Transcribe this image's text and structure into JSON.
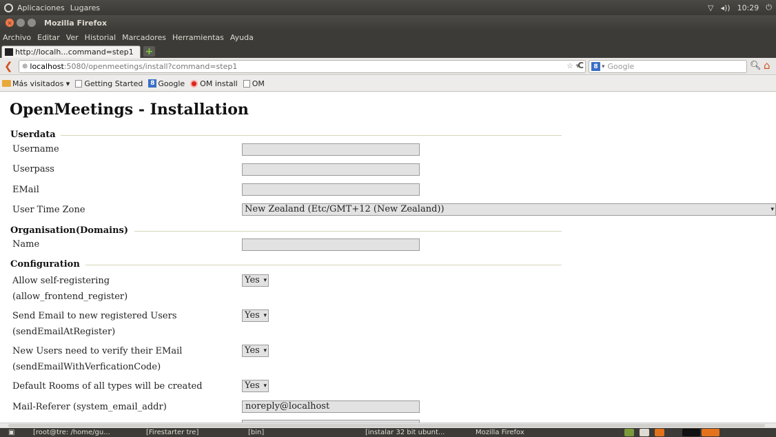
{
  "top_panel": {
    "menus": [
      "Aplicaciones",
      "Lugares"
    ],
    "clock": "10:29"
  },
  "window": {
    "title": "Mozilla Firefox"
  },
  "menu_bar": [
    "Archivo",
    "Editar",
    "Ver",
    "Historial",
    "Marcadores",
    "Herramientas",
    "Ayuda"
  ],
  "tab": {
    "label": "http://localh...command=step1"
  },
  "nav": {
    "url_host": "localhost",
    "url_path": ":5080/openmeetings/install?command=step1",
    "search_placeholder": "Google"
  },
  "bookmarks": [
    "Más visitados ▾",
    "Getting Started",
    "Google",
    "OM install",
    "OM"
  ],
  "page": {
    "heading": "OpenMeetings - Installation",
    "sections": {
      "userdata": "Userdata",
      "organisation": "Organisation(Domains)",
      "configuration": "Configuration"
    },
    "fields": {
      "username": "Username",
      "userpass": "Userpass",
      "email": "EMail",
      "timezone": "User Time Zone",
      "timezone_value": "New Zealand (Etc/GMT+12 (New Zealand))",
      "org_name": "Name",
      "allow_register_1": "Allow self-registering",
      "allow_register_2": "(allow_frontend_register)",
      "send_email_1": "Send Email to new registered Users",
      "send_email_2": "(sendEmailAtRegister)",
      "verify_1": "New Users need to verify their EMail",
      "verify_2": "(sendEmailWithVerficationCode)",
      "default_rooms": "Default Rooms of all types will be created",
      "mail_referer": "Mail-Referer (system_email_addr)",
      "mail_referer_value": "noreply@localhost",
      "yes": "Yes"
    }
  },
  "taskbar": [
    "[root@tre: /home/gu...",
    "[Firestarter tre]",
    "[bin]",
    "[instalar 32 bit ubunt...",
    "Mozilla Firefox"
  ]
}
